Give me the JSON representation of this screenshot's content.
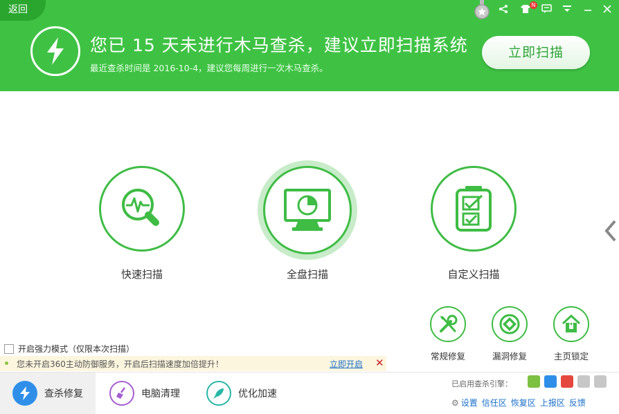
{
  "header": {
    "back_label": "返回",
    "title": "您已 15 天未进行木马查杀，建议立即扫描系统",
    "subtitle": "最近查杀时间是 2016-10-4，建议您每周进行一次木马查杀。",
    "scan_now_label": "立即扫描",
    "notification_badge": "N",
    "accent_color": "#3fc244"
  },
  "toolbar": {
    "icons": [
      "medal-icon",
      "share-icon",
      "skin-icon",
      "message-icon",
      "menu-icon",
      "minimize-icon",
      "close-icon"
    ]
  },
  "scan_options": [
    {
      "label": "快速扫描",
      "icon": "quick-scan-icon"
    },
    {
      "label": "全盘扫描",
      "icon": "full-scan-icon"
    },
    {
      "label": "自定义扫描",
      "icon": "custom-scan-icon"
    }
  ],
  "tools": [
    {
      "label": "常规修复",
      "icon": "wrench-icon"
    },
    {
      "label": "漏洞修复",
      "icon": "patch-icon"
    },
    {
      "label": "主页锁定",
      "icon": "home-lock-icon"
    }
  ],
  "strong_mode": {
    "label": "开启强力模式（仅限本次扫描）",
    "checked": false
  },
  "notice": {
    "text": "您未开启360主动防御服务，开启后扫描速度加倍提升！",
    "link": "立即开启"
  },
  "bottom_nav": [
    {
      "label": "查杀修复",
      "icon": "bolt-icon",
      "active": true
    },
    {
      "label": "电脑清理",
      "icon": "broom-icon",
      "active": false
    },
    {
      "label": "优化加速",
      "icon": "rocket-icon",
      "active": false
    }
  ],
  "engines": {
    "label": "已启用查杀引擎："
  },
  "bottom_links": [
    "设置",
    "信任区",
    "恢复区",
    "上报区",
    "反馈"
  ]
}
